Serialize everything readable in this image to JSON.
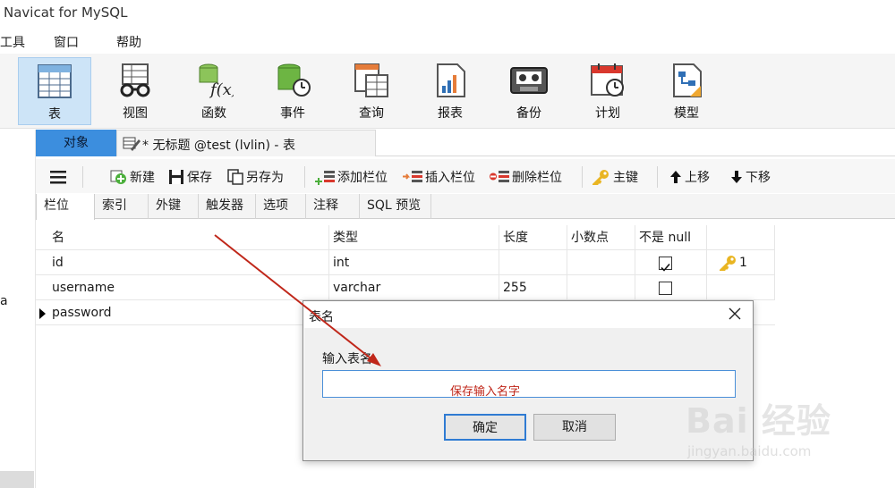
{
  "window": {
    "title": "Navicat for MySQL"
  },
  "menu": [
    "工具",
    "窗口",
    "帮助"
  ],
  "ribbon": [
    {
      "label": "表",
      "icon": "table-icon",
      "active": true
    },
    {
      "label": "视图",
      "icon": "view-glasses-icon"
    },
    {
      "label": "函数",
      "icon": "function-icon"
    },
    {
      "label": "事件",
      "icon": "event-clock-icon"
    },
    {
      "label": "查询",
      "icon": "query-icon"
    },
    {
      "label": "报表",
      "icon": "report-icon"
    },
    {
      "label": "备份",
      "icon": "backup-tape-icon"
    },
    {
      "label": "计划",
      "icon": "schedule-calendar-icon"
    },
    {
      "label": "模型",
      "icon": "model-icon"
    }
  ],
  "tabs": {
    "objects": "对象",
    "document": "* 无标题 @test (lvlin) - 表"
  },
  "toolbar": {
    "new": "新建",
    "save": "保存",
    "save_as": "另存为",
    "add_field": "添加栏位",
    "insert_field": "插入栏位",
    "delete_field": "删除栏位",
    "primary_key": "主键",
    "move_up": "上移",
    "move_down": "下移"
  },
  "subtabs": [
    "栏位",
    "索引",
    "外键",
    "触发器",
    "选项",
    "注释",
    "SQL 预览"
  ],
  "grid": {
    "headers": [
      "名",
      "类型",
      "长度",
      "小数点",
      "不是 null",
      ""
    ],
    "rows": [
      {
        "name": "id",
        "type": "int",
        "length": "",
        "decimals": "",
        "not_null": true,
        "key": "1"
      },
      {
        "name": "username",
        "type": "varchar",
        "length": "255",
        "decimals": "",
        "not_null": false,
        "key": ""
      },
      {
        "name": "password",
        "type": "",
        "length": "",
        "decimals": "",
        "not_null": false,
        "key": ""
      }
    ]
  },
  "left_fragment": "a",
  "dialog": {
    "title": "表名",
    "label": "输入表名",
    "input_value": "",
    "ok": "确定",
    "cancel": "取消"
  },
  "annotation": {
    "text": "保存输入名字",
    "color": "#c0271a"
  },
  "watermark": {
    "brand": "Bai 经验",
    "url": "jingyan.baidu.com"
  },
  "colors": {
    "accent": "#3c8ede",
    "ribbon_active": "#cde4f7",
    "annotation": "#c0271a"
  }
}
